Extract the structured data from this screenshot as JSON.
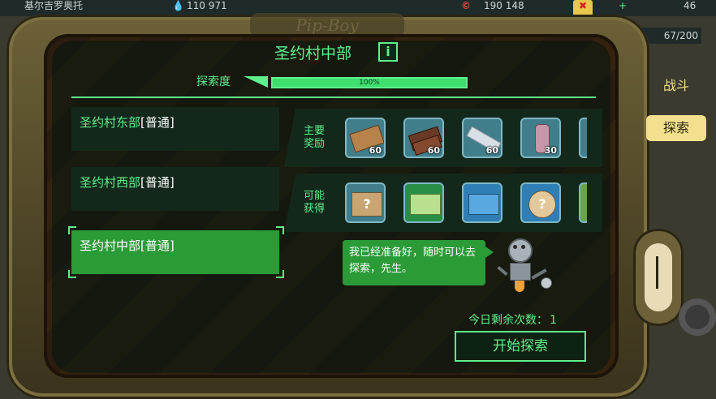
{
  "topbar": {
    "location": "基尔吉罗奥托",
    "water": "110 971",
    "caps": "190 148",
    "stat_a": "46",
    "capacity": "67/200"
  },
  "device": {
    "brand": "Pip-Boy"
  },
  "header": {
    "title": "圣约村中部",
    "info_icon": "i"
  },
  "exploration": {
    "label": "探索度",
    "percent_text": "100%",
    "percent": 100
  },
  "regions": [
    {
      "name": "圣约村东部",
      "level": "[普通]",
      "selected": false
    },
    {
      "name": "圣约村西部",
      "level": "[普通]",
      "selected": false
    },
    {
      "name": "圣约村中部",
      "level": "[普通]",
      "selected": true
    }
  ],
  "rewards": {
    "main_label": [
      "主要",
      "奖励"
    ],
    "main_items": [
      {
        "icon": "wood-plank-icon",
        "qty": "60"
      },
      {
        "icon": "steel-ingot-icon",
        "qty": "60"
      },
      {
        "icon": "aluminum-bar-icon",
        "qty": "60"
      },
      {
        "icon": "fabric-roll-icon",
        "qty": "30"
      }
    ],
    "possible_label": [
      "可能",
      "获得"
    ],
    "possible_items": [
      {
        "icon": "mystery-box-icon"
      },
      {
        "icon": "cash-bundle-icon"
      },
      {
        "icon": "supply-crate-icon"
      },
      {
        "icon": "mystery-paw-icon"
      }
    ]
  },
  "robot": {
    "message": "我已经准备好，随时可以去探索，先生。",
    "icon": "mr-handy-robot-icon"
  },
  "remaining": {
    "label": "今日剩余次数：",
    "count": "1"
  },
  "actions": {
    "start_label": "开始探索"
  },
  "side_tabs": [
    {
      "label": "战斗",
      "active": false
    },
    {
      "label": "探索",
      "active": true
    }
  ],
  "colors": {
    "accent": "#5ff08c",
    "selected": "#2a9b37",
    "tab_active": "#f2e08e"
  }
}
